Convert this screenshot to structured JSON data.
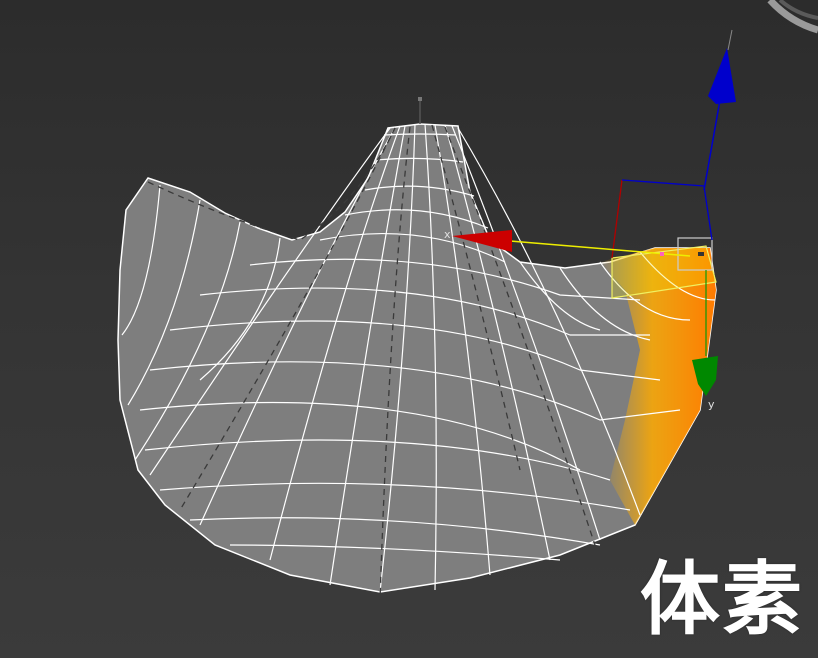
{
  "viewport": {
    "background": "#343434",
    "mesh_color": "#7f7f7f",
    "wire_color": "#ffffff",
    "soft_selection_colors": [
      "#ff6a00",
      "#ffa600",
      "#e8b436"
    ]
  },
  "gizmo": {
    "x_axis_color": "#cc0000",
    "y_axis_color": "#008800",
    "z_axis_color": "#0000cc",
    "x_label": "x",
    "y_label": "y"
  },
  "watermark": {
    "text": "体素"
  }
}
